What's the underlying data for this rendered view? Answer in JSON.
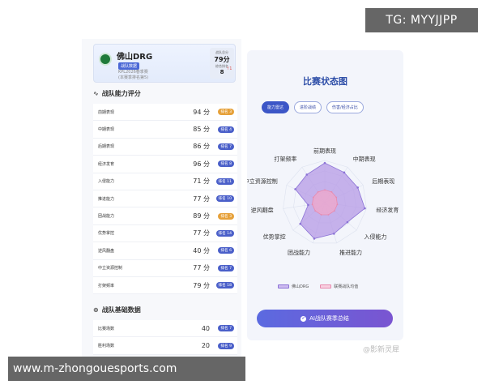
{
  "watermarks": {
    "top": "TG: MYYJJPP",
    "bottom": "www.m-zhongouesports.com",
    "weibo": "@影新灵犀"
  },
  "team": {
    "name": "佛山DRG",
    "badge": "战队数据",
    "season": "KPL2026春季赛",
    "sub": "(本赛季排名第5)",
    "score_label": "战队总分",
    "score": "79分",
    "rank_label": "综合排名",
    "rank": "8",
    "tag": "↑1"
  },
  "ability": {
    "title": "战队能力评分",
    "rows": [
      {
        "label": "前期表现",
        "score": "94 分",
        "rank": "排名 3",
        "gold": true
      },
      {
        "label": "中期表现",
        "score": "85 分",
        "rank": "排名 4",
        "gold": false
      },
      {
        "label": "后期表现",
        "score": "86 分",
        "rank": "排名 7",
        "gold": false
      },
      {
        "label": "经济发育",
        "score": "96 分",
        "rank": "排名 8",
        "gold": false
      },
      {
        "label": "入侵能力",
        "score": "71 分",
        "rank": "排名 11",
        "gold": false
      },
      {
        "label": "推进能力",
        "score": "77 分",
        "rank": "排名 10",
        "gold": false
      },
      {
        "label": "团战能力",
        "score": "89 分",
        "rank": "排名 3",
        "gold": true
      },
      {
        "label": "优势掌控",
        "score": "77 分",
        "rank": "排名 14",
        "gold": false
      },
      {
        "label": "逆风翻盘",
        "score": "40 分",
        "rank": "排名 6",
        "gold": false
      },
      {
        "label": "中立资源控制",
        "score": "77 分",
        "rank": "排名 7",
        "gold": false
      },
      {
        "label": "打架频率",
        "score": "79 分",
        "rank": "排名 18",
        "gold": false
      }
    ]
  },
  "basic": {
    "title": "战队基础数据",
    "rows": [
      {
        "label": "比赛场数",
        "score": "40",
        "rank": "排名 7",
        "gold": false
      },
      {
        "label": "胜利场数",
        "score": "20",
        "rank": "排名 9",
        "gold": false
      }
    ]
  },
  "status_panel": {
    "title": "比赛状态图",
    "tabs": [
      "能力雷达",
      "进阶战绩",
      "伤害/经济占比"
    ],
    "legend_team": "佛山DRG",
    "legend_avg": "联赛战队均值",
    "ai_button": "AI战队赛季总结"
  },
  "colors": {
    "accent": "#3c56c7",
    "team_fill": "#b59ae6",
    "avg_fill": "#f3a7c7",
    "gold_badge": "#e6a13a"
  },
  "chart_data": {
    "type": "radar",
    "axes": [
      "前期表现",
      "中期表现",
      "后期表现",
      "经济发育",
      "入侵能力",
      "推进能力",
      "团战能力",
      "优势掌控",
      "逆风翻盘",
      "中立资源控制",
      "打架频率"
    ],
    "max": 100,
    "series": [
      {
        "name": "佛山DRG",
        "values": [
          94,
          85,
          86,
          96,
          71,
          77,
          89,
          77,
          40,
          77,
          79
        ]
      },
      {
        "name": "联赛战队均值",
        "values": [
          30,
          30,
          30,
          30,
          30,
          30,
          30,
          30,
          30,
          30,
          30
        ]
      }
    ]
  }
}
